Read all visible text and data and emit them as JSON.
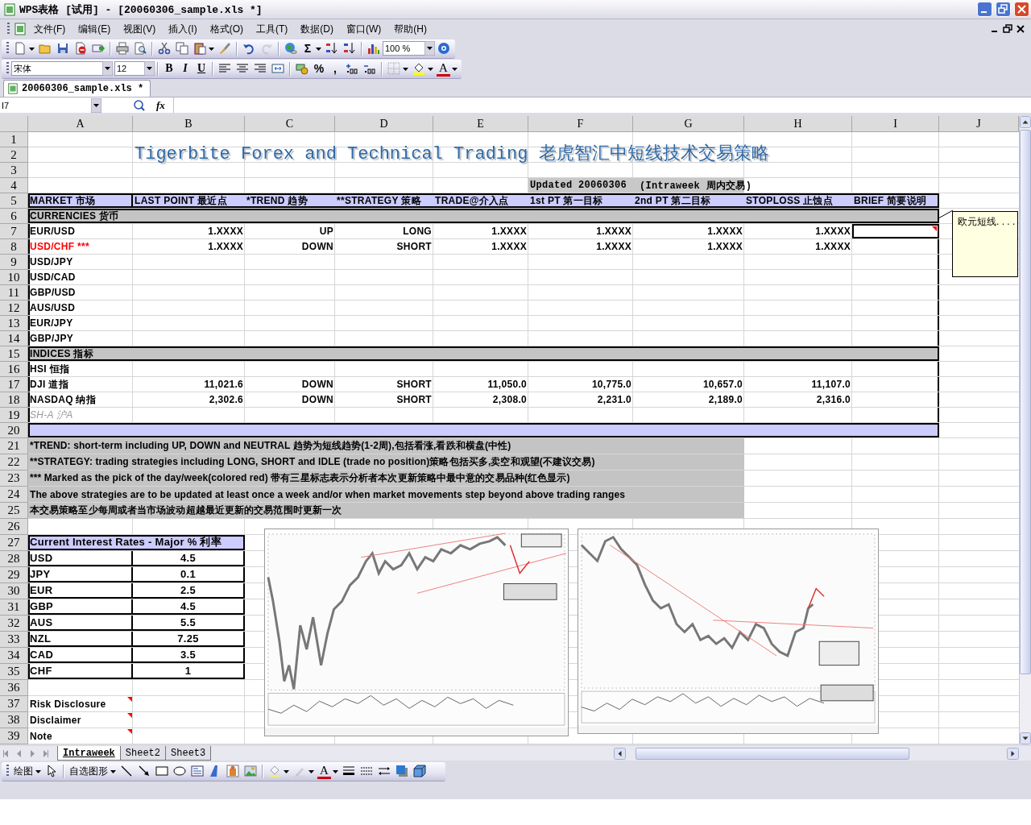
{
  "window": {
    "title": "WPS表格 [试用] - [20060306_sample.xls *]"
  },
  "menu": [
    "文件(F)",
    "编辑(E)",
    "视图(V)",
    "插入(I)",
    "格式(O)",
    "工具(T)",
    "数据(D)",
    "窗口(W)",
    "帮助(H)"
  ],
  "standard_toolbar": {
    "sum": "Σ",
    "zoom": "100 %"
  },
  "format_toolbar": {
    "font": "宋体",
    "size": "12",
    "bold": "B",
    "italic": "I",
    "underline": "U",
    "percent": "%",
    "comma": ",",
    "font_color": "A"
  },
  "document_tab": {
    "label": "20060306_sample.xls *",
    "selected": true
  },
  "formula_bar": {
    "name_box": "I7",
    "fx": "fx"
  },
  "columns": [
    "A",
    "B",
    "C",
    "D",
    "E",
    "F",
    "G",
    "H",
    "I",
    "J"
  ],
  "rows": [
    {
      "number": "1",
      "kind": "blank"
    },
    {
      "number": "2",
      "kind": "title",
      "text": "Tigerbite Forex and Technical Trading 老虎智汇中短线技术交易策略"
    },
    {
      "number": "3",
      "kind": "blank"
    },
    {
      "number": "4",
      "kind": "updated",
      "text": "Updated 20060306",
      "period": "(Intraweek 周内交易)"
    },
    {
      "number": "5",
      "kind": "header",
      "cells": [
        "MARKET 市场",
        "LAST POINT 最近点",
        "*TREND 趋势",
        "**STRATEGY 策略",
        "TRADE@介入点",
        "1st PT 第一目标",
        "2nd PT 第二目标",
        "STOPLOSS 止蚀点",
        "BRIEF 简要说明"
      ]
    },
    {
      "number": "6",
      "kind": "section",
      "text": "CURRENCIES 货币"
    },
    {
      "number": "7",
      "kind": "data",
      "market": "EUR/USD",
      "pick": false,
      "muted": false,
      "selected": true,
      "comment": true,
      "values": [
        "1.XXXX",
        "UP",
        "LONG",
        "1.XXXX",
        "1.XXXX",
        "1.XXXX",
        "1.XXXX"
      ]
    },
    {
      "number": "8",
      "kind": "data",
      "market": "USD/CHF ***",
      "pick": true,
      "muted": false,
      "selected": false,
      "comment": false,
      "values": [
        "1.XXXX",
        "DOWN",
        "SHORT",
        "1.XXXX",
        "1.XXXX",
        "1.XXXX",
        "1.XXXX"
      ]
    },
    {
      "number": "9",
      "kind": "data",
      "market": "USD/JPY",
      "pick": false,
      "muted": false,
      "selected": false,
      "comment": false
    },
    {
      "number": "10",
      "kind": "data",
      "market": "USD/CAD",
      "pick": false,
      "muted": false,
      "selected": false,
      "comment": false
    },
    {
      "number": "11",
      "kind": "data",
      "market": "GBP/USD",
      "pick": false,
      "muted": false,
      "selected": false,
      "comment": false
    },
    {
      "number": "12",
      "kind": "data",
      "market": "AUS/USD",
      "pick": false,
      "muted": false,
      "selected": false,
      "comment": false
    },
    {
      "number": "13",
      "kind": "data",
      "market": "EUR/JPY",
      "pick": false,
      "muted": false,
      "selected": false,
      "comment": false
    },
    {
      "number": "14",
      "kind": "data",
      "market": "GBP/JPY",
      "pick": false,
      "muted": false,
      "selected": false,
      "comment": false
    },
    {
      "number": "15",
      "kind": "section",
      "text": "INDICES 指标"
    },
    {
      "number": "16",
      "kind": "data",
      "market": "HSI 恒指",
      "pick": false,
      "muted": false,
      "selected": false,
      "comment": false
    },
    {
      "number": "17",
      "kind": "data",
      "market": "DJI 道指",
      "pick": false,
      "muted": false,
      "selected": false,
      "comment": false,
      "values": [
        "11,021.6",
        "DOWN",
        "SHORT",
        "11,050.0",
        "10,775.0",
        "10,657.0",
        "11,107.0"
      ]
    },
    {
      "number": "18",
      "kind": "data",
      "market": "NASDAQ 纳指",
      "pick": false,
      "muted": false,
      "selected": false,
      "comment": false,
      "values": [
        "2,302.6",
        "DOWN",
        "SHORT",
        "2,308.0",
        "2,231.0",
        "2,189.0",
        "2,316.0"
      ]
    },
    {
      "number": "19",
      "kind": "data",
      "market": "SH-A 沪A",
      "pick": false,
      "muted": true,
      "selected": false,
      "comment": false
    },
    {
      "number": "20",
      "kind": "band"
    },
    {
      "number": "21",
      "kind": "note",
      "text": "*TREND: short-term including UP, DOWN and NEUTRAL 趋势为短线趋势(1-2周),包括看涨,看跌和横盘(中性)"
    },
    {
      "number": "22",
      "kind": "note",
      "text": "**STRATEGY: trading strategies including LONG, SHORT and IDLE (trade no position)策略包括买多,卖空和观望(不建议交易)"
    },
    {
      "number": "23",
      "kind": "note",
      "text": "*** Marked as the pick of the day/week(colored red) 带有三星标志表示分析者本次更新策略中最中意的交易品种(红色显示)"
    },
    {
      "number": "24",
      "kind": "note",
      "text": "The above strategies are to be updated at least once a week and/or when market movements step beyond above trading ranges"
    },
    {
      "number": "25",
      "kind": "note",
      "text": "本交易策略至少每周或者当市场波动超越最近更新的交易范围时更新一次"
    },
    {
      "number": "26",
      "kind": "blank"
    },
    {
      "number": "27",
      "kind": "rates_header",
      "text": "Current Interest Rates - Major % 利率"
    },
    {
      "number": "28",
      "kind": "rate",
      "currency": "USD",
      "rate": "4.5"
    },
    {
      "number": "29",
      "kind": "rate",
      "currency": "JPY",
      "rate": "0.1"
    },
    {
      "number": "30",
      "kind": "rate",
      "currency": "EUR",
      "rate": "2.5"
    },
    {
      "number": "31",
      "kind": "rate",
      "currency": "GBP",
      "rate": "4.5"
    },
    {
      "number": "32",
      "kind": "rate",
      "currency": "AUS",
      "rate": "5.5"
    },
    {
      "number": "33",
      "kind": "rate",
      "currency": "NZL",
      "rate": "7.25"
    },
    {
      "number": "34",
      "kind": "rate",
      "currency": "CAD",
      "rate": "3.5"
    },
    {
      "number": "35",
      "kind": "rate",
      "currency": "CHF",
      "rate": "1"
    },
    {
      "number": "36",
      "kind": "blank"
    },
    {
      "number": "37",
      "kind": "link",
      "text": "Risk Disclosure",
      "comment": true
    },
    {
      "number": "38",
      "kind": "link",
      "text": "Disclaimer",
      "comment": true
    },
    {
      "number": "39",
      "kind": "link",
      "text": "Note",
      "comment": true
    }
  ],
  "comment": {
    "text": "欧元短线. . . ."
  },
  "charts": [
    {
      "kind": "picture"
    },
    {
      "kind": "picture"
    }
  ],
  "sheet_tabs": [
    {
      "label": "Intraweek",
      "selected": true
    },
    {
      "label": "Sheet2",
      "selected": false
    },
    {
      "label": "Sheet3",
      "selected": false
    }
  ],
  "drawing_toolbar": {
    "draw": "绘图",
    "autoshapes": "自选图形",
    "font_color": "A"
  }
}
